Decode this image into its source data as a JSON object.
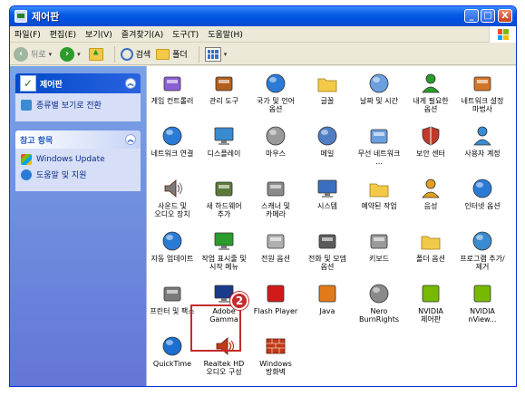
{
  "window": {
    "title": "제어판",
    "minimize": "_",
    "maximize": "□",
    "close": "X"
  },
  "menu": [
    "파일(F)",
    "편집(E)",
    "보기(V)",
    "즐겨찾기(A)",
    "도구(T)",
    "도움말(H)"
  ],
  "toolbar": {
    "back": "뒤로",
    "search": "검색",
    "folders": "폴더",
    "dropdown": "▾"
  },
  "sidebar": {
    "main_panel_title": "제어판",
    "switch_view": "종류별 보기로 전환",
    "see_also_title": "참고 항목",
    "links": [
      "Windows Update",
      "도움말 및 지원"
    ]
  },
  "items": [
    {
      "label": "게임 컨트롤러",
      "icon": "game-controller-icon",
      "color": "#8a5fd0"
    },
    {
      "label": "관리 도구",
      "icon": "admin-tools-icon",
      "color": "#b05f1e"
    },
    {
      "label": "국가 및 언어 옵션",
      "icon": "globe-icon",
      "color": "#2a7bd6"
    },
    {
      "label": "글꼴",
      "icon": "fonts-folder-icon",
      "color": "#f3c94a"
    },
    {
      "label": "날짜 및 시간",
      "icon": "clock-icon",
      "color": "#6a9fe0"
    },
    {
      "label": "내게 필요한 옵션",
      "icon": "accessibility-icon",
      "color": "#2b9b2b"
    },
    {
      "label": "네트워크 설정 마법사",
      "icon": "network-wizard-icon",
      "color": "#d0762a"
    },
    {
      "label": "네트워크 연결",
      "icon": "network-connections-icon",
      "color": "#2a7bd6"
    },
    {
      "label": "디스플레이",
      "icon": "display-icon",
      "color": "#3a8bd0"
    },
    {
      "label": "마우스",
      "icon": "mouse-icon",
      "color": "#9a9a9a"
    },
    {
      "label": "메일",
      "icon": "mail-icon",
      "color": "#4f7ec4"
    },
    {
      "label": "무선 네트워크 ...",
      "icon": "wireless-icon",
      "color": "#6a9fe0"
    },
    {
      "label": "보안 센터",
      "icon": "security-shield-icon",
      "color": "#c0392b"
    },
    {
      "label": "사용자 계정",
      "icon": "user-accounts-icon",
      "color": "#3a8bd0"
    },
    {
      "label": "사운드 및 오디오 장치",
      "icon": "sound-icon",
      "color": "#7a7a7a"
    },
    {
      "label": "새 하드웨어 추가",
      "icon": "add-hardware-icon",
      "color": "#5a7a3a"
    },
    {
      "label": "스캐너 및 카메라",
      "icon": "scanner-camera-icon",
      "color": "#8a8a8a"
    },
    {
      "label": "시스템",
      "icon": "system-icon",
      "color": "#3a6fc0"
    },
    {
      "label": "예약된 작업",
      "icon": "scheduled-tasks-icon",
      "color": "#f3c94a"
    },
    {
      "label": "음성",
      "icon": "speech-icon",
      "color": "#e0a020"
    },
    {
      "label": "인터넷 옵션",
      "icon": "internet-options-icon",
      "color": "#2a7bd6"
    },
    {
      "label": "자동 업데이트",
      "icon": "auto-update-icon",
      "color": "#2a7bd6"
    },
    {
      "label": "작업 표시줄 및 시작 메뉴",
      "icon": "taskbar-icon",
      "color": "#2b9b2b"
    },
    {
      "label": "전원 옵션",
      "icon": "power-icon",
      "color": "#b0b0b0"
    },
    {
      "label": "전화 및 모뎀 옵션",
      "icon": "phone-modem-icon",
      "color": "#5a5a5a"
    },
    {
      "label": "키보드",
      "icon": "keyboard-icon",
      "color": "#9a9a9a"
    },
    {
      "label": "폴더 옵션",
      "icon": "folder-options-icon",
      "color": "#f3c94a"
    },
    {
      "label": "프로그램 추가/제거",
      "icon": "add-remove-programs-icon",
      "color": "#3a8bd0"
    },
    {
      "label": "프린터 및 팩스",
      "icon": "printer-icon",
      "color": "#7a7a7a"
    },
    {
      "label": "Adobe Gamma",
      "icon": "adobe-gamma-icon",
      "color": "#1a3a8a"
    },
    {
      "label": "Flash Player",
      "icon": "flash-player-icon",
      "color": "#d01a1a"
    },
    {
      "label": "Java",
      "icon": "java-icon",
      "color": "#e07a1a"
    },
    {
      "label": "Nero BurnRights",
      "icon": "nero-icon",
      "color": "#8a8a8a"
    },
    {
      "label": "NVIDIA 제어판",
      "icon": "nvidia-icon",
      "color": "#76b900"
    },
    {
      "label": "NVIDIA nView...",
      "icon": "nvidia-nview-icon",
      "color": "#76b900"
    },
    {
      "label": "QuickTime",
      "icon": "quicktime-icon",
      "color": "#1a6fd0"
    },
    {
      "label": "Realtek HD 오디오 구성",
      "icon": "realtek-speaker-icon",
      "color": "#c0391b"
    },
    {
      "label": "Windows 방화벽",
      "icon": "firewall-icon",
      "color": "#c0391b"
    }
  ],
  "callout": {
    "number": "2"
  }
}
